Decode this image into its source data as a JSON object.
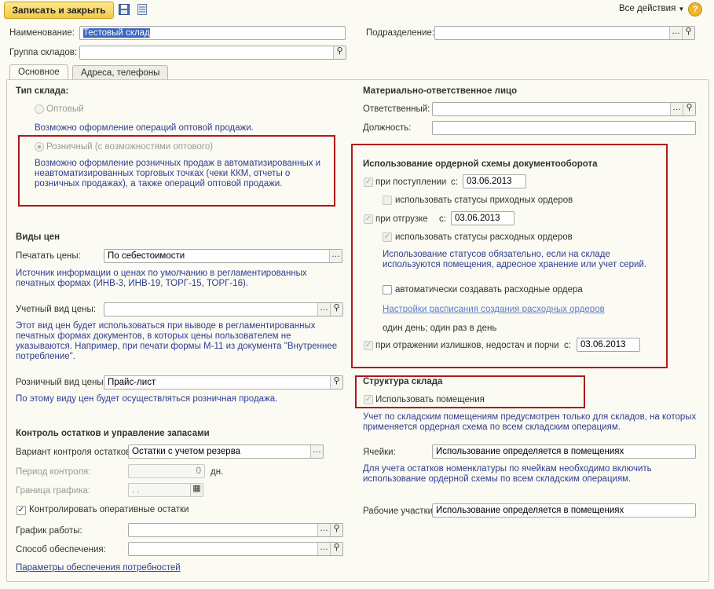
{
  "toolbar": {
    "save_close_label": "Записать и закрыть",
    "all_actions_label": "Все действия",
    "help_label": "?"
  },
  "header": {
    "name_label": "Наименование:",
    "name_value": "Тестовый склад",
    "group_label": "Группа складов:",
    "group_value": "",
    "division_label": "Подразделение:",
    "division_value": ""
  },
  "tabs": [
    {
      "label": "Основное"
    },
    {
      "label": "Адреса, телефоны"
    }
  ],
  "type": {
    "title": "Тип склада:",
    "wholesale_label": "Оптовый",
    "wholesale_info": "Возможно оформление операций оптовой продажи.",
    "retail_label": "Розничный (с возможностями оптового)",
    "retail_info": "Возможно оформление розничных продаж в автоматизированных и неавтоматизированных торговых точках (чеки ККМ, отчеты о розничных продажах), а также операций оптовой продажи."
  },
  "prices": {
    "title": "Виды цен",
    "print_label": "Печатать цены:",
    "print_value": "По себестоимости",
    "print_info": "Источник информации о ценах по умолчанию в регламентированных печатных формах (ИНВ-3, ИНВ-19, ТОРГ-15, ТОРГ-16).",
    "account_label": "Учетный вид цены:",
    "account_value": "",
    "account_info": "Этот вид цен будет использоваться при выводе в регламентированных печатных формах документов, в которых цены пользователем не указываются. Например, при печати формы М-11 из документа \"Внутреннее потребление\".",
    "retail_label": "Розничный вид цены:",
    "retail_value": "Прайс-лист",
    "retail_info": "По этому виду цен будет осуществляться розничная продажа."
  },
  "stock": {
    "title": "Контроль остатков и управление запасами",
    "variant_label": "Вариант контроля остатков:",
    "variant_value": "Остатки с учетом резерва",
    "period_label": "Период контроля:",
    "period_value": "0",
    "period_unit": "дн.",
    "border_label": "Граница графика:",
    "border_value": " .  .",
    "operative_label": "Контролировать оперативные остатки",
    "schedule_label": "График работы:",
    "schedule_value": "",
    "supply_label": "Способ обеспечения:",
    "supply_value": "",
    "params_link": "Параметры обеспечения потребностей"
  },
  "responsible": {
    "title": "Материально-ответственное лицо",
    "person_label": "Ответственный:",
    "person_value": "",
    "position_label": "Должность:",
    "position_value": ""
  },
  "order_scheme": {
    "title": "Использование ордерной схемы документооборота",
    "receipt_label": "при поступлении",
    "receipt_from": "с:",
    "receipt_date": "03.06.2013",
    "receipt_status_label": "использовать статусы приходных ордеров",
    "shipment_label": "при отгрузке",
    "shipment_from": "с:",
    "shipment_date": "03.06.2013",
    "shipment_status_label": "использовать статусы расходных ордеров",
    "status_info": "Использование статусов обязательно, если на складе используются помещения, адресное хранение или учет серий.",
    "auto_label": "автоматически создавать расходные ордера",
    "schedule_link": "Настройки расписания создания расходных ордеров",
    "schedule_text": "один день; один раз в день",
    "surplus_label": "при отражении излишков, недостач и порчи",
    "surplus_from": "с:",
    "surplus_date": "03.06.2013"
  },
  "structure": {
    "title": "Структура склада",
    "rooms_label": "Использовать помещения",
    "rooms_info": "Учет по складским помещениям предусмотрен только для складов, на которых применяется ордерная схема  по всем складским операциям.",
    "cells_label": "Ячейки:",
    "cells_value": "Использование определяется в помещениях",
    "cells_info": "Для учета остатков номенклатуры по ячейкам необходимо включить использование ордерной схемы по всем складским операциям.",
    "areas_label": "Рабочие участки:",
    "areas_value": "Использование определяется в помещениях"
  },
  "colors": {
    "accent_button": "#f2c84b",
    "info_text": "#2f3d91",
    "highlight_box": "#b01a1a"
  }
}
